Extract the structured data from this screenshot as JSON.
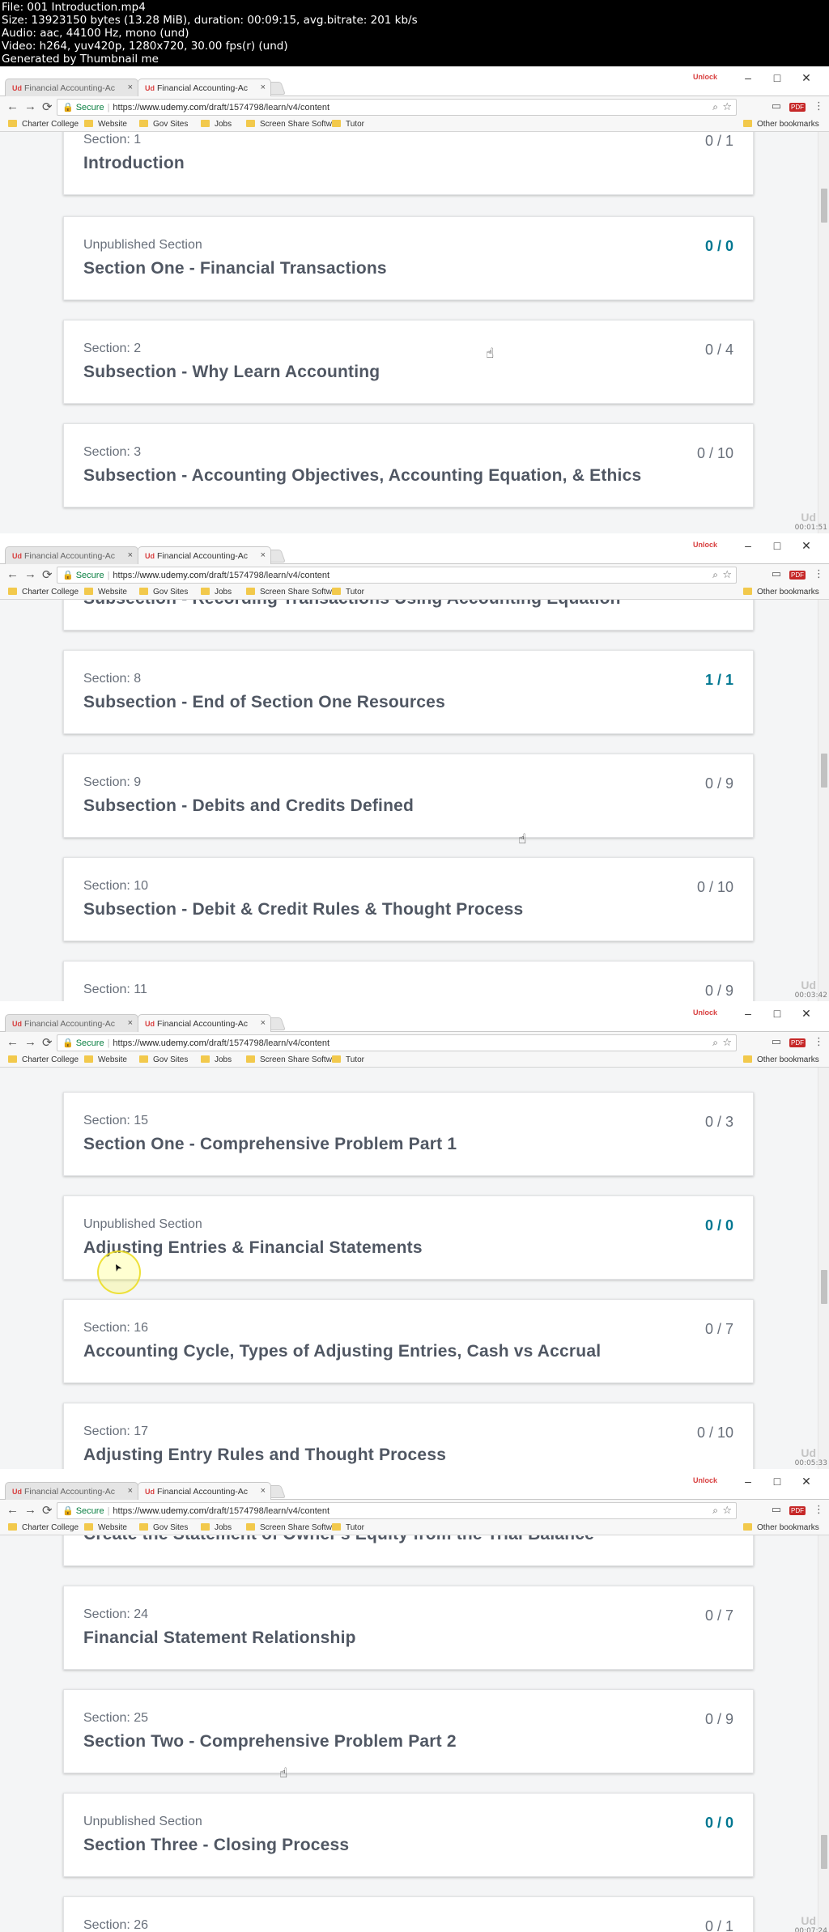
{
  "file_info": [
    "File: 001 Introduction.mp4",
    "Size: 13923150 bytes (13.28 MiB), duration: 00:09:15, avg.bitrate: 201 kb/s",
    "Audio: aac, 44100 Hz, mono (und)",
    "Video: h264, yuv420p, 1280x720, 30.00 fps(r) (und)",
    "Generated by Thumbnail me"
  ],
  "browser": {
    "tabs": [
      {
        "label": "Financial Accounting-Ac",
        "active": false
      },
      {
        "label": "Financial Accounting-Ac",
        "active": true
      }
    ],
    "tab_favicon": "Ud",
    "tab_close": "×",
    "extension_badge": "Unlock",
    "window_buttons": {
      "minimize": "–",
      "maximize": "□",
      "close": "✕"
    },
    "nav": {
      "back": "←",
      "forward": "→",
      "reload": "⟳"
    },
    "address": {
      "lock": "🔒",
      "secure_label": "Secure",
      "url_scheme": "https://",
      "url_host": "www.udemy.com",
      "url_path": "/draft/1574798/learn/v4/content"
    },
    "toolbar_icons": {
      "zoom": "⌕",
      "star": "☆",
      "cast": "▭",
      "pdf": "PDF",
      "menu": "⋮"
    },
    "bookmarks": [
      "Charter College",
      "Website",
      "Gov Sites",
      "Jobs",
      "Screen Share Softwa",
      "Tutor"
    ],
    "other_bookmarks": "Other bookmarks"
  },
  "frames": [
    {
      "timestamp": "00:01:51",
      "cards": [
        {
          "sub": "Section: 1",
          "title": "Introduction",
          "progress": "0 / 1",
          "done": false
        },
        {
          "sub": "Unpublished Section",
          "title": "Section One - Financial Transactions",
          "progress": "0 / 0",
          "done": true
        },
        {
          "sub": "Section: 2",
          "title": "Subsection - Why Learn Accounting",
          "progress": "0 / 4",
          "done": false
        },
        {
          "sub": "Section: 3",
          "title": "Subsection - Accounting Objectives, Accounting Equation, & Ethics",
          "progress": "0 / 10",
          "done": false
        }
      ]
    },
    {
      "timestamp": "00:03:42",
      "cards": [
        {
          "sub": "",
          "title": "Subsection - Recording Transactions Using Accounting Equation",
          "progress": "",
          "done": false
        },
        {
          "sub": "Section: 8",
          "title": "Subsection - End of Section One Resources",
          "progress": "1 / 1",
          "done": true
        },
        {
          "sub": "Section: 9",
          "title": "Subsection - Debits and Credits Defined",
          "progress": "0 / 9",
          "done": false
        },
        {
          "sub": "Section: 10",
          "title": "Subsection - Debit & Credit Rules & Thought Process",
          "progress": "0 / 10",
          "done": false
        },
        {
          "sub": "Section: 11",
          "title": "",
          "progress": "0 / 9",
          "done": false
        }
      ]
    },
    {
      "timestamp": "00:05:33",
      "cards": [
        {
          "sub": "Section: 15",
          "title": "Section One - Comprehensive Problem Part 1",
          "progress": "0 / 3",
          "done": false
        },
        {
          "sub": "Unpublished Section",
          "title": "Adjusting Entries & Financial Statements",
          "progress": "0 / 0",
          "done": true
        },
        {
          "sub": "Section: 16",
          "title": "Accounting Cycle, Types of Adjusting Entries, Cash vs Accrual",
          "progress": "0 / 7",
          "done": false
        },
        {
          "sub": "Section: 17",
          "title": "Adjusting Entry Rules and Thought Process",
          "progress": "0 / 10",
          "done": false
        }
      ]
    },
    {
      "timestamp": "00:07:24",
      "cards": [
        {
          "sub": "",
          "title": "Create the Statement of Owner's Equity from the Trial Balance",
          "progress": "",
          "done": false
        },
        {
          "sub": "Section: 24",
          "title": "Financial Statement Relationship",
          "progress": "0 / 7",
          "done": false
        },
        {
          "sub": "Section: 25",
          "title": "Section Two - Comprehensive Problem Part 2",
          "progress": "0 / 9",
          "done": false
        },
        {
          "sub": "Unpublished Section",
          "title": "Section Three - Closing Process",
          "progress": "0 / 0",
          "done": true
        },
        {
          "sub": "Section: 26",
          "title": "",
          "progress": "0 / 1",
          "done": false
        }
      ]
    }
  ],
  "watermark": "Ud",
  "cursor_glyph": "☝",
  "arrow_glyph": "➤",
  "colors": {
    "progress_done": "#007791",
    "text_title": "#505763",
    "text_sub": "#686f7a"
  }
}
